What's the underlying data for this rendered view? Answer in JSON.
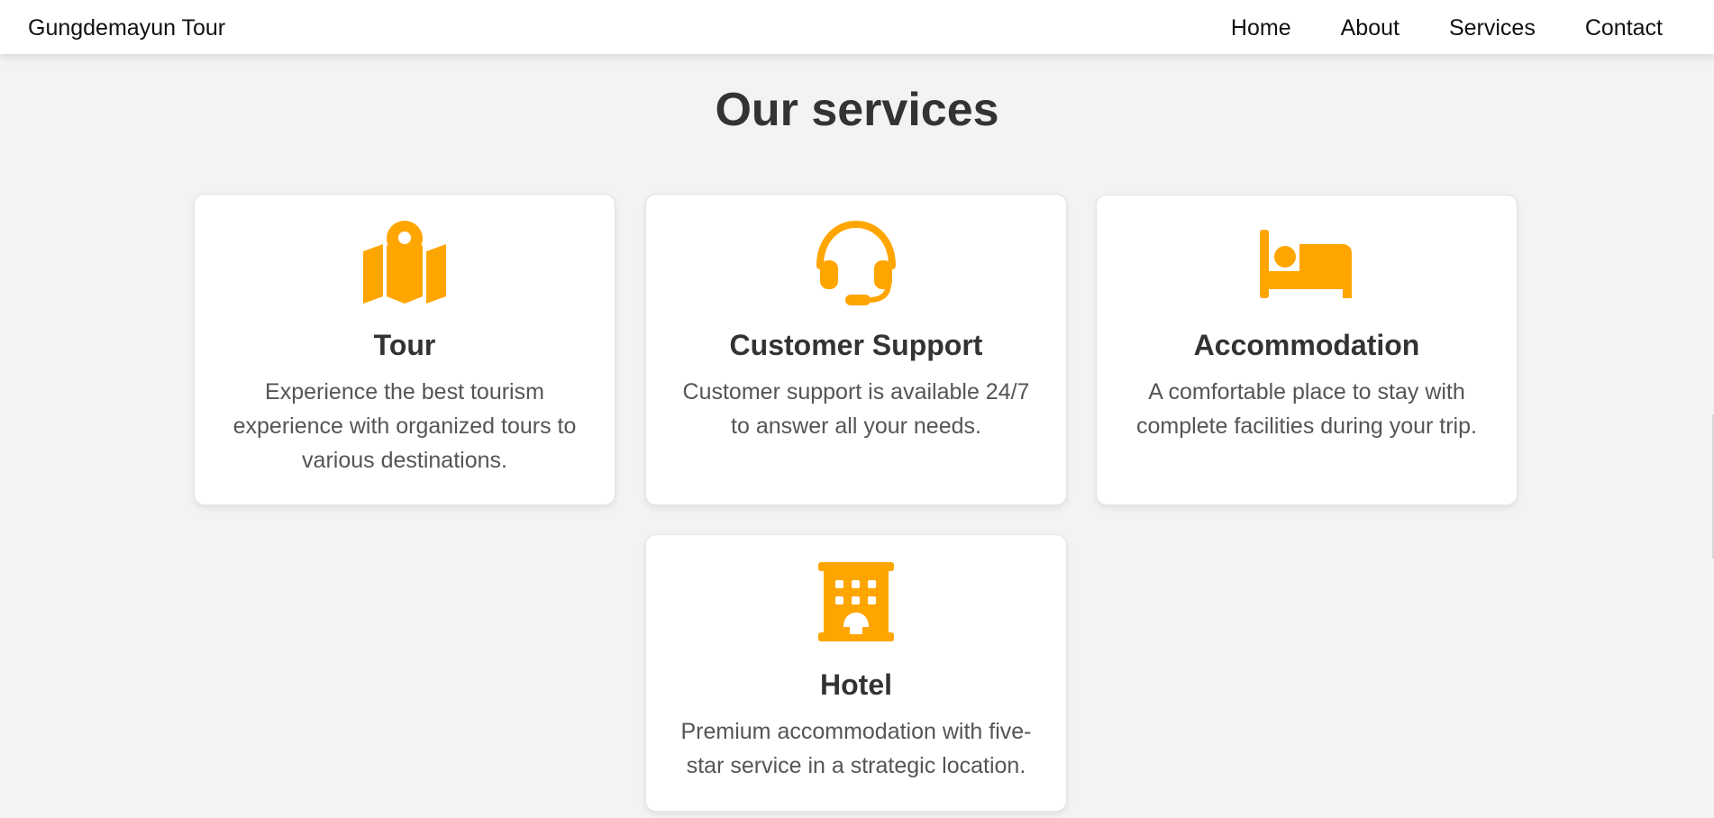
{
  "navbar": {
    "brand": "Gungdemayun Tour",
    "links": [
      "Home",
      "About",
      "Services",
      "Contact"
    ]
  },
  "main": {
    "title": "Our services",
    "services": [
      {
        "icon": "map-location-icon",
        "title": "Tour",
        "description": "Experience the best tourism experience with organized tours to various destinations."
      },
      {
        "icon": "headset-icon",
        "title": "Customer Support",
        "description": "Customer support is available 24/7 to answer all your needs."
      },
      {
        "icon": "bed-icon",
        "title": "Accommodation",
        "description": "A comfortable place to stay with complete facilities during your trip."
      },
      {
        "icon": "hotel-building-icon",
        "title": "Hotel",
        "description": "Premium accommodation with five-star service in a strategic location."
      }
    ]
  },
  "colors": {
    "accent": "#FFA500",
    "background": "#f3f3f3",
    "text_dark": "#333333",
    "text_body": "#555555"
  }
}
